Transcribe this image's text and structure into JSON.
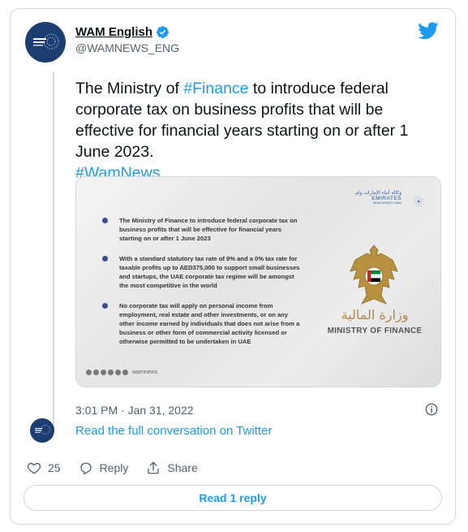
{
  "author": {
    "name": "WAM English",
    "handle": "@WAMNEWS_ENG"
  },
  "tweet": {
    "text_1": "The Ministry of ",
    "hashtag_finance": "#Finance",
    "text_2": " to introduce federal corporate tax on business profits that will be effective for financial years starting on or after 1 June 2023.",
    "hashtag_wam": "#WamNews"
  },
  "media": {
    "bullets": [
      "The Ministry of Finance to introduce federal corporate tax on business profits that will be effective for financial years starting on or after 1 June 2023",
      "With a standard statutory tax rate of 9% and a 0% tax rate for taxable profits up to AED375,000 to support small businesses and startups, the UAE corporate tax regime will be amongst the most competitive in the world",
      "No corporate tax will apply on personal income from employment, real estate and other investments, or on any other income earned by individuals that does not arise from a business or other form of commercial activity licensed or otherwise permitted to be undertaken in UAE"
    ],
    "emirates_ar": "وكالة أنباء الإمارات وام",
    "emirates_en": "EMIRATES",
    "emirates_sub": "NEWS AGENCY WAM",
    "ministry_ar": "وزارة المالية",
    "ministry_en": "MINISTRY OF FINANCE",
    "social_handle": "wamnews"
  },
  "timestamp": "3:01 PM · Jan 31, 2022",
  "read_conversation": "Read the full conversation on Twitter",
  "actions": {
    "likes": "25",
    "reply": "Reply",
    "share": "Share"
  },
  "read_reply": "Read 1 reply",
  "colors": {
    "accent": "#1d9bf0",
    "text": "#0f1419",
    "muted": "#536471",
    "border": "#cfd9de"
  }
}
